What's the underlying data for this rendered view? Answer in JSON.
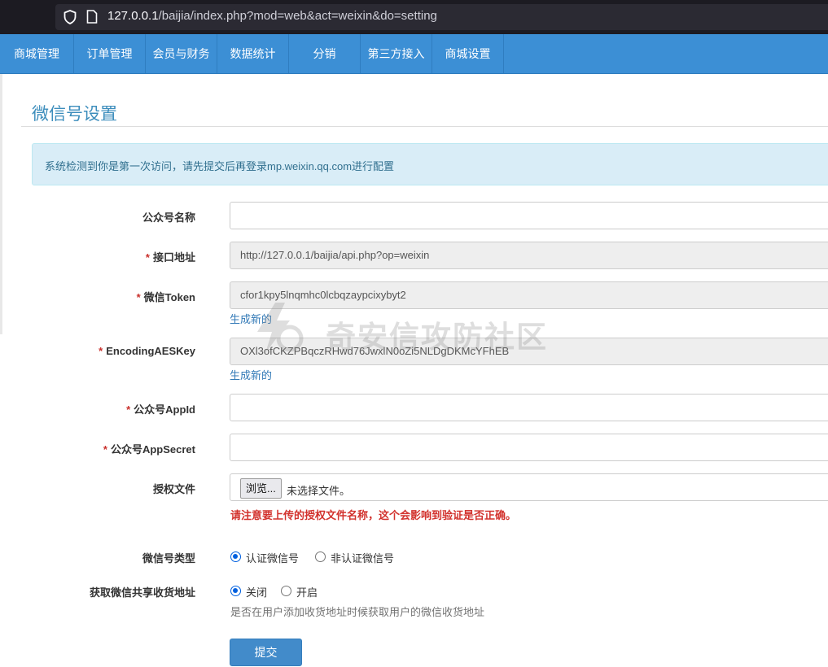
{
  "browser": {
    "url_host": "127.0.0.1",
    "url_path": "/baijia/index.php?mod=web&act=weixin&do=setting"
  },
  "nav": {
    "items": [
      {
        "label": "商城管理"
      },
      {
        "label": "订单管理"
      },
      {
        "label": "会员与财务"
      },
      {
        "label": "数据统计"
      },
      {
        "label": "分销"
      },
      {
        "label": "第三方接入"
      },
      {
        "label": "商城设置"
      }
    ]
  },
  "page": {
    "title": "微信号设置",
    "alert": "系统检测到你是第一次访问，请先提交后再登录mp.weixin.qq.com进行配置"
  },
  "form": {
    "required_mark": "*",
    "account_name": {
      "label": "公众号名称",
      "value": ""
    },
    "api_url": {
      "label": "接口地址",
      "value": "http://127.0.0.1/baijia/api.php?op=weixin"
    },
    "token": {
      "label": "微信Token",
      "value": "cfor1kpy5lnqmhc0lcbqzaypcixybyt2",
      "generate": "生成新的"
    },
    "aes_key": {
      "label": "EncodingAESKey",
      "value": "OXl3ofCKZPBqczRHwd76JwxlN0oZi5NLDgDKMcYFhEB",
      "generate": "生成新的"
    },
    "app_id": {
      "label": "公众号AppId",
      "value": ""
    },
    "app_secret": {
      "label": "公众号AppSecret",
      "value": ""
    },
    "auth_file": {
      "label": "授权文件",
      "browse": "浏览...",
      "status": "未选择文件。",
      "warning": "请注意要上传的授权文件名称，这个会影响到验证是否正确。"
    },
    "account_type": {
      "label": "微信号类型",
      "options": [
        "认证微信号",
        "非认证微信号"
      ],
      "selected": "认证微信号"
    },
    "share_address": {
      "label": "获取微信共享收货地址",
      "options": [
        "关闭",
        "开启"
      ],
      "selected": "关闭",
      "help": "是否在用户添加收货地址时候获取用户的微信收货地址"
    },
    "submit": "提交"
  },
  "watermark": {
    "text": "奇安信攻防社区"
  },
  "colors": {
    "nav_bg": "#3c8fd5",
    "title": "#3c8dbc",
    "alert_bg": "#d9edf7",
    "link": "#337ab7",
    "warning": "#d2322d",
    "button": "#428bca"
  }
}
